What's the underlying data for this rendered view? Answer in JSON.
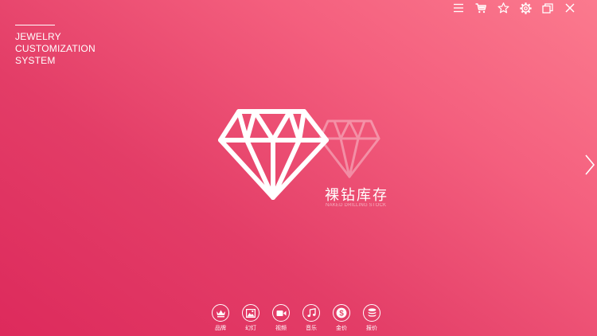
{
  "brand": {
    "line1": "JEWELRY",
    "line2": "CUSTOMIZATION",
    "line3": "SYSTEM"
  },
  "toolbar": {
    "buttons": [
      {
        "name": "menu",
        "icon": "menu-icon"
      },
      {
        "name": "cart",
        "icon": "cart-icon"
      },
      {
        "name": "favorite",
        "icon": "star-icon"
      },
      {
        "name": "settings",
        "icon": "gear-icon"
      },
      {
        "name": "restore",
        "icon": "restore-window-icon"
      },
      {
        "name": "close",
        "icon": "close-icon"
      }
    ]
  },
  "hero": {
    "title_cn": "裸钻库存",
    "title_en": "NAKED DRILLING STOCK",
    "icon": "diamond-icon"
  },
  "navigation": {
    "next_icon": "chevron-right-icon"
  },
  "bottom_nav": [
    {
      "label": "品牌",
      "icon": "crown-icon"
    },
    {
      "label": "幻灯",
      "icon": "image-icon"
    },
    {
      "label": "视频",
      "icon": "video-camera-icon"
    },
    {
      "label": "音乐",
      "icon": "music-note-icon"
    },
    {
      "label": "金价",
      "icon": "dollar-icon"
    },
    {
      "label": "报价",
      "icon": "coin-stack-icon"
    }
  ],
  "colors": {
    "gradient_start": "#dd2a5c",
    "gradient_end": "#fb7a8e",
    "foreground": "#ffffff"
  }
}
